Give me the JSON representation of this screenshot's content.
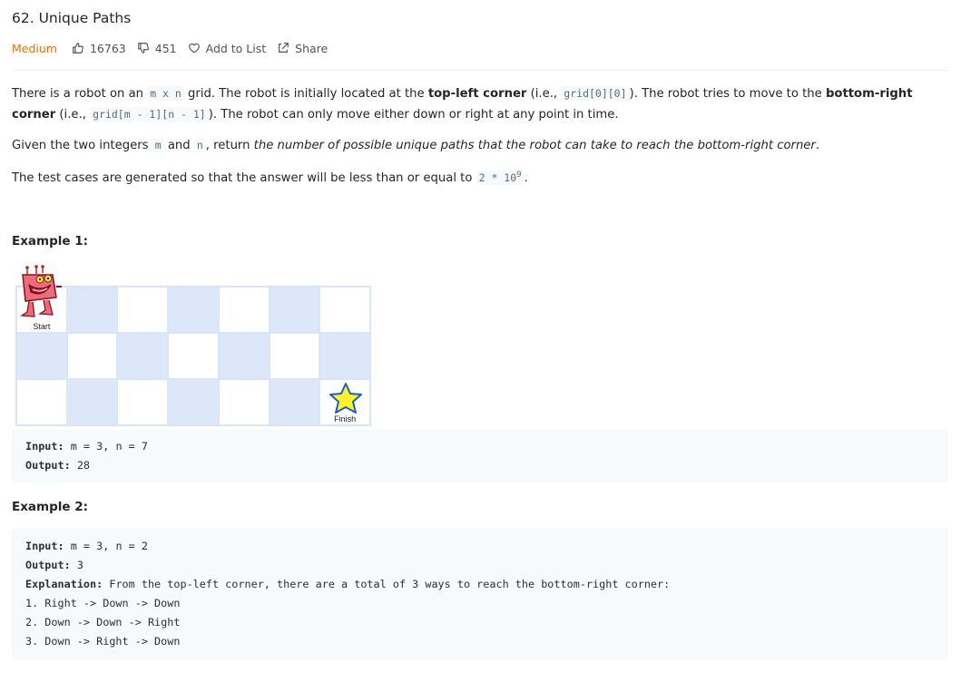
{
  "problem": {
    "title": "62. Unique Paths",
    "difficulty": "Medium",
    "likes": "16763",
    "dislikes": "451",
    "add_to_list": "Add to List",
    "share": "Share"
  },
  "description": {
    "p1_a": "There is a robot on an ",
    "p1_code1": "m x n",
    "p1_b": " grid. The robot is initially located at the ",
    "p1_bold1": "top-left corner",
    "p1_c": " (i.e., ",
    "p1_code2": "grid[0][0]",
    "p1_d": "). The robot tries to move to the ",
    "p1_bold2": "bottom-right corner",
    "p1_e": " (i.e., ",
    "p1_code3": "grid[m - 1][n - 1]",
    "p1_f": "). The robot can only move either down or right at any point in time.",
    "p2_a": "Given the two integers ",
    "p2_code1": "m",
    "p2_b": " and ",
    "p2_code2": "n",
    "p2_c": ", return ",
    "p2_italic": "the number of possible unique paths that the robot can take to reach the bottom-right corner",
    "p2_d": ".",
    "p3_a": "The test cases are generated so that the answer will be less than or equal to ",
    "p3_code": "2 * 10",
    "p3_sup": "9",
    "p3_b": "."
  },
  "example1": {
    "title": "Example 1:",
    "start_label": "Start",
    "finish_label": "Finish",
    "input_label": "Input:",
    "input_value": " m = 3, n = 7",
    "output_label": "Output:",
    "output_value": " 28"
  },
  "example2": {
    "title": "Example 2:",
    "input_label": "Input:",
    "input_value": " m = 3, n = 2",
    "output_label": "Output:",
    "output_value": " 3",
    "explanation_label": "Explanation:",
    "explanation_value": " From the top-left corner, there are a total of 3 ways to reach the bottom-right corner:",
    "steps": [
      "1. Right -> Down -> Down",
      "2. Down -> Down -> Right",
      "3. Down -> Right -> Down"
    ]
  },
  "colors": {
    "difficulty": "#ef6c00",
    "grid_blue": "#dce8fa",
    "code_bg": "#f7f9fa"
  }
}
